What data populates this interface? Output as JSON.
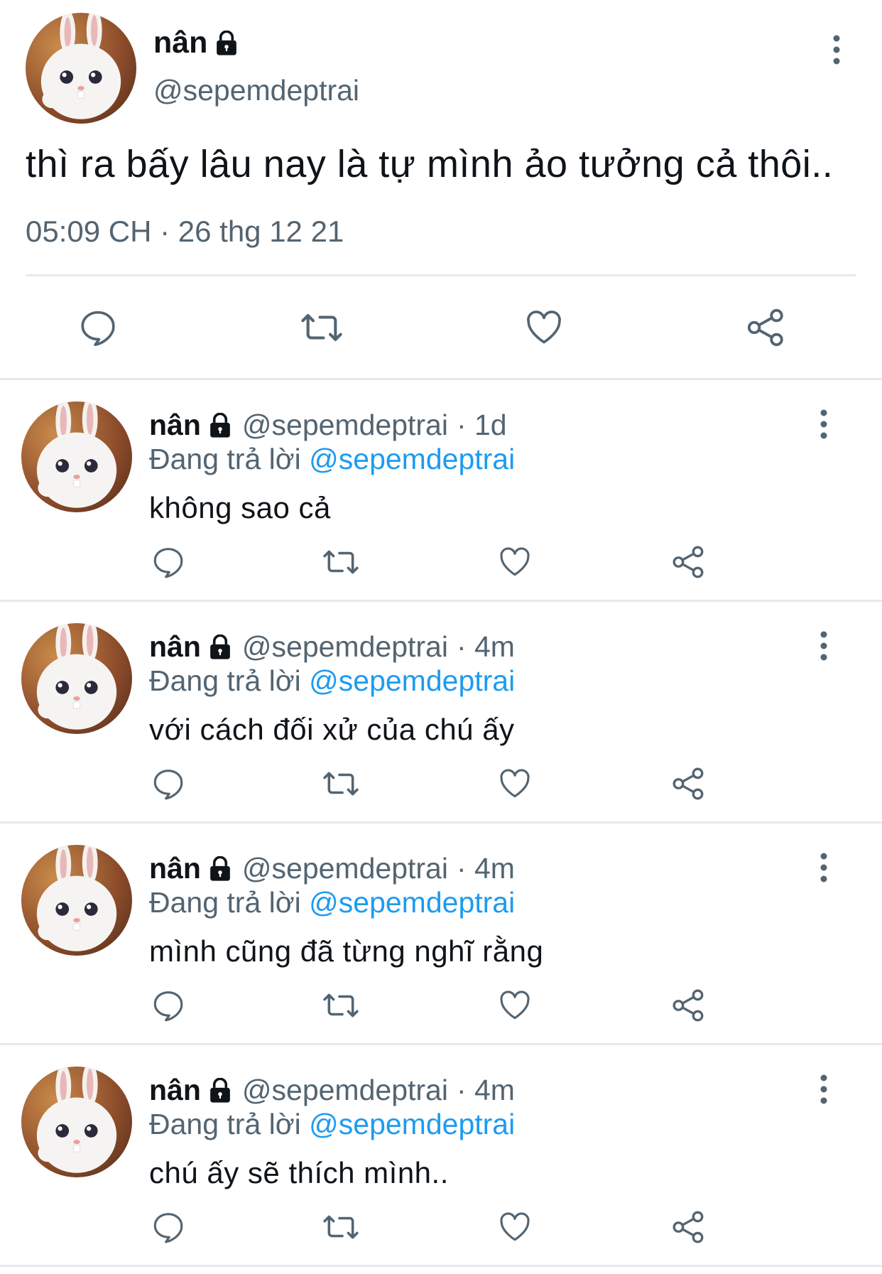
{
  "main_tweet": {
    "author_name": "nân",
    "handle": "@sepemdeptrai",
    "text": "thì ra bấy lâu nay là tự mình ảo tưởng cả thôi..",
    "timestamp": "05:09 CH · 26 thg 12 21",
    "locked_icon": "lock-icon",
    "actions": [
      "reply-icon",
      "retweet-icon",
      "like-icon",
      "share-icon"
    ]
  },
  "replies": [
    {
      "author_name": "nân",
      "handle": "@sepemdeptrai",
      "time": "· 1d",
      "replying_label": "Đang trả lời",
      "replying_to": "@sepemdeptrai",
      "text": "không sao cả"
    },
    {
      "author_name": "nân",
      "handle": "@sepemdeptrai",
      "time": "· 4m",
      "replying_label": "Đang trả lời",
      "replying_to": "@sepemdeptrai",
      "text": "với cách đối xử của chú ấy"
    },
    {
      "author_name": "nân",
      "handle": "@sepemdeptrai",
      "time": "· 4m",
      "replying_label": "Đang trả lời",
      "replying_to": "@sepemdeptrai",
      "text": "mình cũng đã từng nghĩ rằng"
    },
    {
      "author_name": "nân",
      "handle": "@sepemdeptrai",
      "time": "· 4m",
      "replying_label": "Đang trả lời",
      "replying_to": "@sepemdeptrai",
      "text": "chú ấy sẽ thích mình.."
    }
  ],
  "colors": {
    "text": "#0f1419",
    "secondary": "#536471",
    "link": "#1d9bf0",
    "divider": "#e6e9ec"
  }
}
